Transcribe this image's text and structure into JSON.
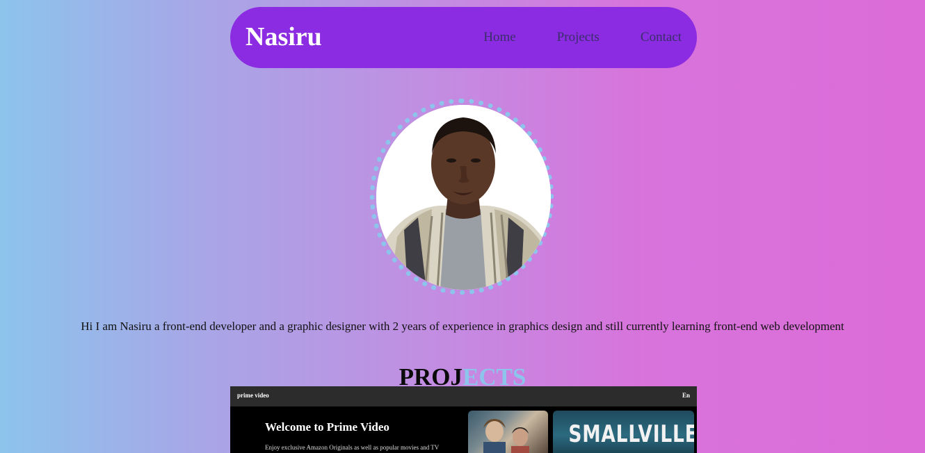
{
  "nav": {
    "brand": "Nasiru",
    "links": [
      "Home",
      "Projects",
      "Contact"
    ]
  },
  "profile": {
    "photo_alt": "Portrait of Nasiru"
  },
  "bio": "Hi I am Nasiru a front-end developer and a graphic designer with 2 years of experience in graphics design and still currently learning front-end web development",
  "projects": {
    "title_part1": "PROJ",
    "title_part2": "ECTS",
    "cards": [
      {
        "logo": "prime video",
        "lang": "En",
        "heading": "Welcome to Prime Video",
        "subtext": "Enjoy exclusive Amazon Originals as well as popular movies and TV",
        "poster_title": "SMALLVILLE"
      }
    ]
  },
  "colors": {
    "nav_bg": "#8b2be2",
    "accent": "#8cc4ec",
    "nav_link": "#3a2f6a"
  }
}
